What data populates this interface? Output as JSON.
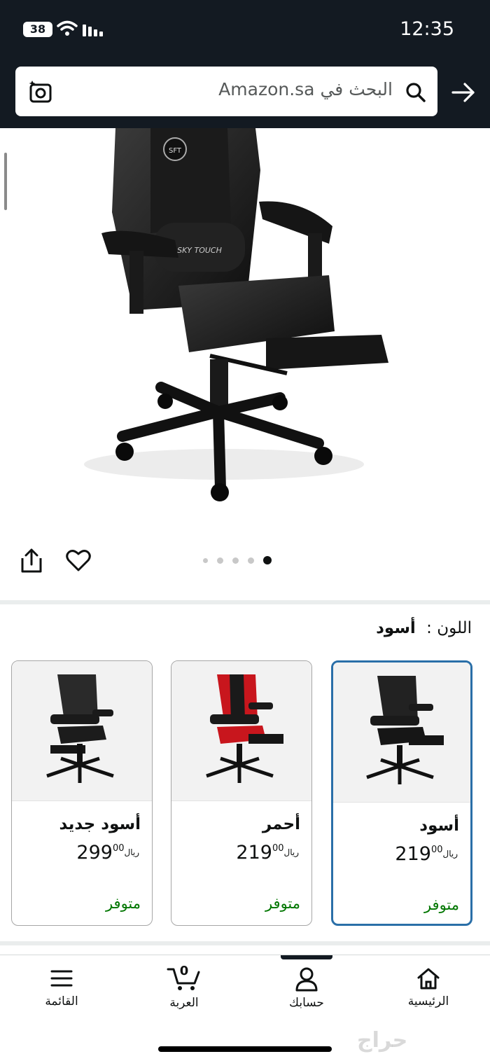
{
  "status_bar": {
    "battery": "38",
    "time": "12:35"
  },
  "search": {
    "placeholder": "البحث في Amazon.sa"
  },
  "product": {
    "image_count": 5,
    "active_image_index": 5
  },
  "color_selector": {
    "label": "اللون :",
    "selected": "أسود"
  },
  "variants": [
    {
      "name": "أسود",
      "currency": "ريال",
      "price_whole": "219",
      "price_fraction": "00",
      "availability": "متوفر",
      "selected": true
    },
    {
      "name": "أحمر",
      "currency": "ريال",
      "price_whole": "219",
      "price_fraction": "00",
      "availability": "متوفر",
      "selected": false
    },
    {
      "name": "أسود جديد",
      "currency": "ريال",
      "price_whole": "299",
      "price_fraction": "00",
      "availability": "متوفر",
      "selected": false
    }
  ],
  "bottom_nav": {
    "home": "الرئيسية",
    "account": "حسابك",
    "cart": "العربة",
    "cart_count": "0",
    "menu": "القائمة"
  },
  "watermark": "حراج",
  "colors": {
    "header_bg": "#131a22",
    "selected_border": "#2a6fa8",
    "availability": "#007600"
  }
}
